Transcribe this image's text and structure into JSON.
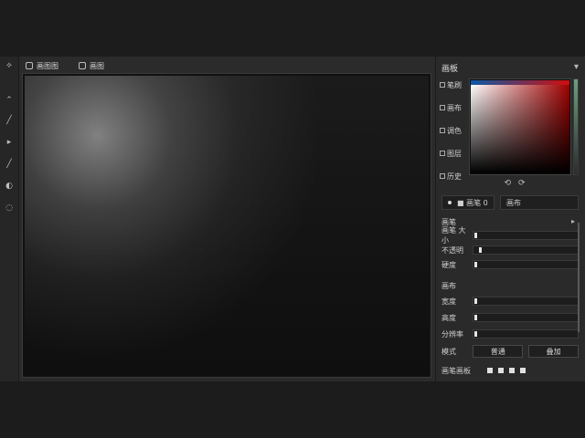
{
  "window": {
    "tabs": [
      {
        "label": "画图图"
      },
      {
        "label": "画图"
      }
    ]
  },
  "left_tools": [
    {
      "icon": "bulb-icon"
    },
    {
      "icon": "chevron-up-icon"
    },
    {
      "icon": "pen-icon"
    },
    {
      "icon": "play-icon"
    },
    {
      "icon": "brush-icon"
    },
    {
      "icon": "eraser-icon"
    },
    {
      "icon": "lasso-icon"
    }
  ],
  "right_panel": {
    "title": "画板",
    "nav": [
      {
        "label": "笔刷"
      },
      {
        "label": "画布"
      },
      {
        "label": "调色"
      },
      {
        "label": "图层"
      },
      {
        "label": "历史"
      }
    ],
    "picker": {
      "swatch_primary": "#0b5aa5",
      "swatch_secondary": "#d10d0d"
    },
    "mini_controls": [
      {
        "icon": "undo-icon",
        "label": "⟲"
      },
      {
        "icon": "redo-icon",
        "label": "⟳"
      }
    ],
    "fields": [
      {
        "label": "■ 画笔 0",
        "value": "0"
      },
      {
        "label": "画布",
        "value": ""
      }
    ],
    "section_brush": {
      "title": "画笔",
      "rows": [
        {
          "label": "画笔 大小",
          "value": 0
        },
        {
          "label": "不透明",
          "value": 0.05
        },
        {
          "label": "硬度",
          "value": 0
        }
      ]
    },
    "section_canvas": {
      "title": "画布",
      "rows": [
        {
          "label": "宽度",
          "value": 0
        },
        {
          "label": "高度",
          "value": 0
        },
        {
          "label": "分辨率",
          "value": 0
        }
      ]
    },
    "mode": {
      "label": "模式",
      "buttons": [
        {
          "label": "普通"
        },
        {
          "label": "叠加"
        }
      ]
    },
    "bottom": {
      "label": "画笔画板",
      "chips": [
        {
          "icon": "square-icon"
        },
        {
          "icon": "square-icon"
        },
        {
          "icon": "square-icon"
        },
        {
          "icon": "square-icon"
        }
      ]
    }
  }
}
